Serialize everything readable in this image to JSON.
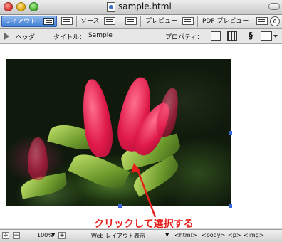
{
  "window": {
    "title": "sample.html"
  },
  "tabs": {
    "layout": "レイアウト",
    "source": "ソース",
    "preview": "プレビュー",
    "pdf_preview": "PDF プレビュー"
  },
  "properties_bar": {
    "header_label": "ヘッダ",
    "title_label": "タイトル：",
    "title_value": "Sample",
    "property_label": "プロパティ："
  },
  "annotation": {
    "text": "クリックして選択する",
    "color": "#e8201c"
  },
  "status_bar": {
    "zoom": "100%",
    "view_mode": "Web レイアウト表示",
    "breadcrumbs": [
      "<html>",
      "<body>",
      "<p>",
      "<img>"
    ]
  },
  "icons": [
    "document-icon",
    "layout-view-icon",
    "source-view-icon",
    "preview-icon",
    "pdf-preview-icon",
    "sync-icon",
    "header-triangle-icon",
    "properties-icon",
    "film-icon",
    "css-icon",
    "dropdown-menu-icon",
    "flower-photo"
  ],
  "colors": {
    "accent_tab": "#3f7ed6",
    "annotation": "#e8201c",
    "selection_handle": "#3a66d6"
  }
}
